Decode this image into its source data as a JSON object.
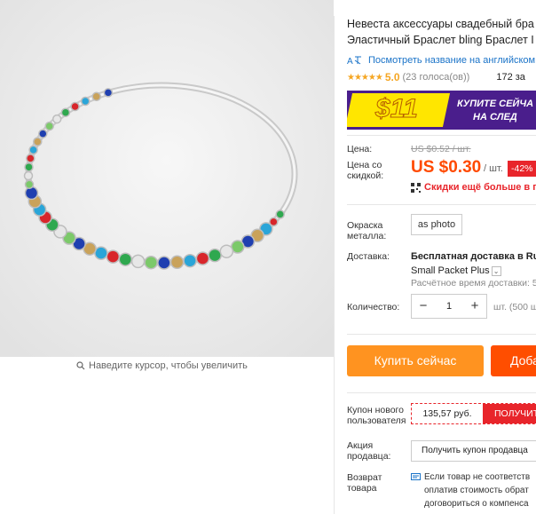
{
  "product": {
    "title_line1": "Невеста аксессуары свадебный бра",
    "title_line2": "Эластичный Браслет bling Браслет I",
    "translate_link": "Посмотреть название на английском",
    "stars": "★★★★★",
    "rating": "5.0",
    "votes": "(23 голоса(ов))",
    "orders": "172 за"
  },
  "banner": {
    "amount": "$11",
    "line1": "КУПИТЕ СЕЙЧА",
    "line2": "НА СЛЕД"
  },
  "price": {
    "label": "Цена:",
    "old": "US $0.52 / шт.",
    "discount_label_1": "Цена со",
    "discount_label_2": "скидкой:",
    "new": "US $0.30",
    "unit": "/ шт.",
    "discount": "-42%",
    "app_discount": "Скидки ещё больше в при"
  },
  "options": {
    "metal_label_1": "Окраска",
    "metal_label_2": "металла:",
    "metal_value": "as photo"
  },
  "shipping": {
    "label": "Доставка:",
    "line1": "Бесплатная доставка в Rus",
    "line2": "Small Packet Plus",
    "delivery_time": "Расчётное время доставки: 5"
  },
  "quantity": {
    "label": "Количество:",
    "value": "1",
    "minus": "−",
    "plus": "+",
    "note": "шт. (500 ш"
  },
  "actions": {
    "buy_now": "Купить сейчас",
    "add_to_cart": "Доба"
  },
  "coupons": {
    "new_user_label_1": "Купон нового",
    "new_user_label_2": "пользователя",
    "new_user_amount": "135,57 руб.",
    "new_user_get": "ПОЛУЧИТЬ",
    "seller_label_1": "Акция",
    "seller_label_2": "продавца:",
    "seller_button": "Получить купон продавца"
  },
  "returns": {
    "label_1": "Возврат",
    "label_2": "товара",
    "line1": "Если товар не соответств",
    "line2": "оплатив стоимость обрат",
    "line3": "договориться о компенса"
  },
  "image": {
    "zoom_hint": "Наведите курсор, чтобы увеличить"
  },
  "colors": {
    "accent_orange": "#ff4a00",
    "buy_button": "#ff9320",
    "link_blue": "#1a73c8",
    "sale_red": "#e8252b"
  }
}
